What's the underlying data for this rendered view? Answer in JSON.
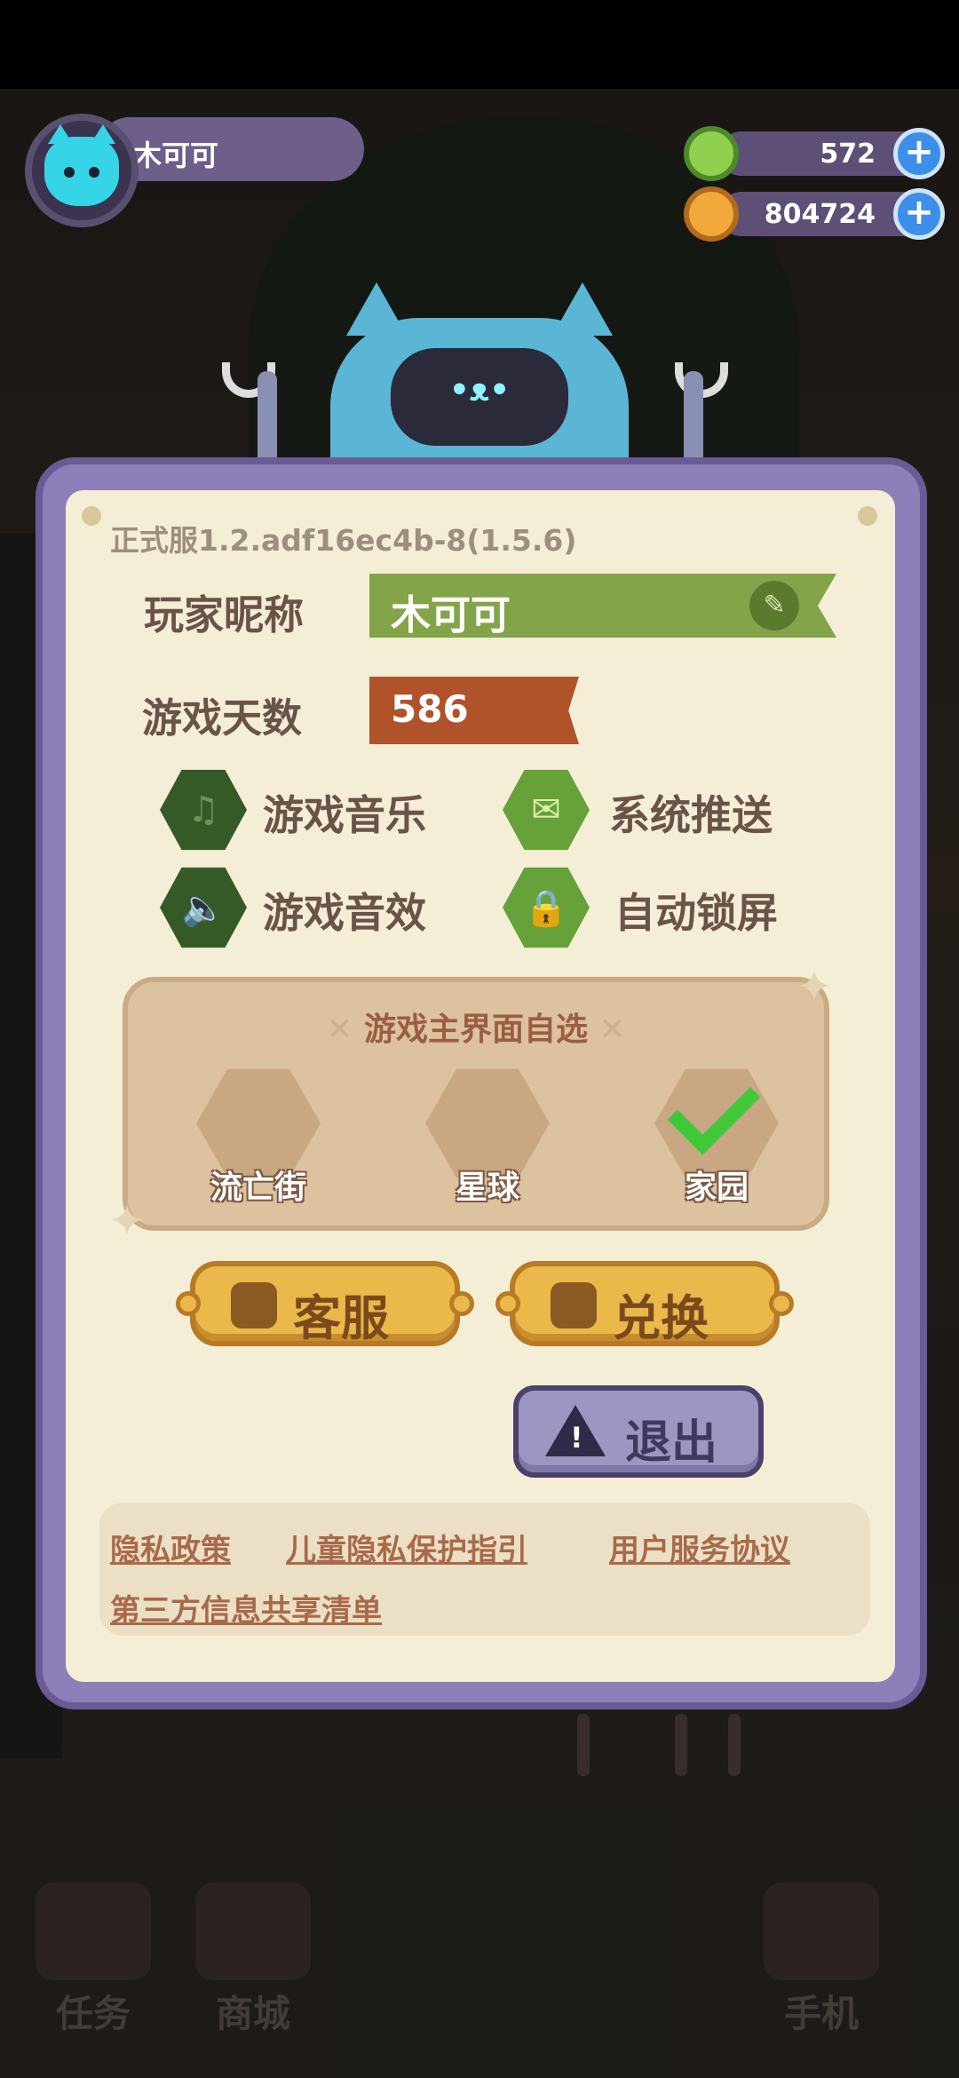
{
  "profile": {
    "name": "木可可"
  },
  "currency": [
    {
      "name": "gem",
      "value": "572",
      "color": "#8fd14f"
    },
    {
      "name": "gold-coin",
      "value": "804724",
      "color": "#f0a93a"
    }
  ],
  "robot": {
    "screen_text": "•ᴥ•"
  },
  "settings": {
    "version": "正式服1.2.adf16ec4b-8(1.5.6)",
    "nickname_label": "玩家昵称",
    "nickname_value": "木可可",
    "days_label": "游戏天数",
    "days_value": "586",
    "toggles": [
      {
        "label": "游戏音乐",
        "icon": "music-note-icon",
        "state": "off"
      },
      {
        "label": "系统推送",
        "icon": "envelope-icon",
        "state": "on"
      },
      {
        "label": "游戏音效",
        "icon": "speaker-icon",
        "state": "off"
      },
      {
        "label": "自动锁屏",
        "icon": "lock-icon",
        "state": "on"
      }
    ],
    "home_select": {
      "title": "游戏主界面自选",
      "options": [
        {
          "label": "流亡街",
          "selected": false
        },
        {
          "label": "星球",
          "selected": false
        },
        {
          "label": "家园",
          "selected": true
        }
      ]
    },
    "buttons": {
      "service": "客服",
      "redeem": "兑换",
      "logout": "退出"
    },
    "links": [
      "隐私政策",
      "儿童隐私保护指引",
      "用户服务协议",
      "第三方信息共享清单"
    ]
  },
  "bottom_nav": [
    "任务",
    "商城",
    "手机"
  ],
  "colors": {
    "panel_frame": "#8e7fba",
    "paper": "#f5eed6",
    "nickname_ribbon": "#83a448",
    "days_ribbon": "#b0532b",
    "toggle_on": "#67a13a",
    "toggle_off": "#365a27"
  }
}
